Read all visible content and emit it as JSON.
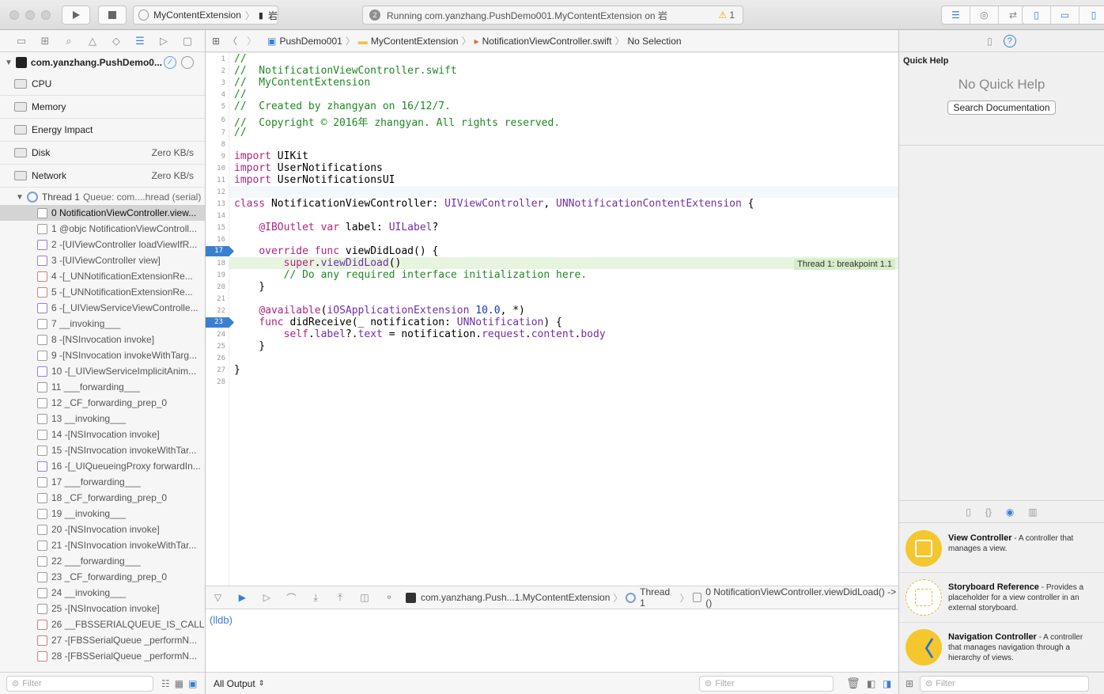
{
  "toolbar": {
    "scheme_target": "MyContentExtension",
    "scheme_device": "岩",
    "status_text": "Running com.yanzhang.PushDemo001.MyContentExtension on 岩",
    "status_badge": "2",
    "warning_count": "1"
  },
  "navigator": {
    "process_name": "com.yanzhang.PushDemo0...",
    "gauges": [
      {
        "label": "CPU",
        "value": ""
      },
      {
        "label": "Memory",
        "value": ""
      },
      {
        "label": "Energy Impact",
        "value": ""
      },
      {
        "label": "Disk",
        "value": "Zero KB/s"
      },
      {
        "label": "Network",
        "value": "Zero KB/s"
      }
    ],
    "thread_label": "Thread 1",
    "thread_queue": "Queue: com....hread (serial)",
    "frames": [
      {
        "text": "0 NotificationViewController.view...",
        "kind": "n"
      },
      {
        "text": "1 @objc NotificationViewControll...",
        "kind": "n"
      },
      {
        "text": "2 -[UIViewController loadViewIfR...",
        "kind": "p"
      },
      {
        "text": "3 -[UIViewController view]",
        "kind": "p"
      },
      {
        "text": "4 -[_UNNotificationExtensionRe...",
        "kind": "r"
      },
      {
        "text": "5 -[_UNNotificationExtensionRe...",
        "kind": "r"
      },
      {
        "text": "6 -[_UIViewServiceViewControlle...",
        "kind": "p"
      },
      {
        "text": "7 __invoking___",
        "kind": "n"
      },
      {
        "text": "8 -[NSInvocation invoke]",
        "kind": "n"
      },
      {
        "text": "9 -[NSInvocation invokeWithTarg...",
        "kind": "n"
      },
      {
        "text": "10 -[_UIViewServiceImplicitAnim...",
        "kind": "p"
      },
      {
        "text": "11 ___forwarding___",
        "kind": "n"
      },
      {
        "text": "12 _CF_forwarding_prep_0",
        "kind": "n"
      },
      {
        "text": "13 __invoking___",
        "kind": "n"
      },
      {
        "text": "14 -[NSInvocation invoke]",
        "kind": "n"
      },
      {
        "text": "15 -[NSInvocation invokeWithTar...",
        "kind": "n"
      },
      {
        "text": "16 -[_UIQueueingProxy forwardIn...",
        "kind": "p"
      },
      {
        "text": "17 ___forwarding___",
        "kind": "n"
      },
      {
        "text": "18 _CF_forwarding_prep_0",
        "kind": "n"
      },
      {
        "text": "19 __invoking___",
        "kind": "n"
      },
      {
        "text": "20 -[NSInvocation invoke]",
        "kind": "n"
      },
      {
        "text": "21 -[NSInvocation invokeWithTar...",
        "kind": "n"
      },
      {
        "text": "22 ___forwarding___",
        "kind": "n"
      },
      {
        "text": "23 _CF_forwarding_prep_0",
        "kind": "n"
      },
      {
        "text": "24 __invoking___",
        "kind": "n"
      },
      {
        "text": "25 -[NSInvocation invoke]",
        "kind": "n"
      },
      {
        "text": "26 __FBSSERIALQUEUE_IS_CALL...",
        "kind": "r"
      },
      {
        "text": "27 -[FBSSerialQueue _performN...",
        "kind": "r"
      },
      {
        "text": "28 -[FBSSerialQueue _performN...",
        "kind": "r"
      }
    ],
    "filter_placeholder": "Filter"
  },
  "jumpbar": {
    "project": "PushDemo001",
    "group": "MyContentExtension",
    "file": "NotificationViewController.swift",
    "selection": "No Selection"
  },
  "editor": {
    "breakpoint_label": "Thread 1: breakpoint 1.1",
    "breakpoint_lines": [
      "17",
      "23"
    ]
  },
  "debugbar": {
    "process": "com.yanzhang.Push...1.MyContentExtension",
    "thread": "Thread 1",
    "frame": "0 NotificationViewController.viewDidLoad() -> ()"
  },
  "console": {
    "prompt": "(lldb)",
    "output_selector": "All Output",
    "filter_placeholder": "Filter"
  },
  "inspector": {
    "title": "Quick Help",
    "empty_text": "No Quick Help",
    "search_button": "Search Documentation",
    "library": [
      {
        "name": "View Controller",
        "desc": " - A controller that manages a view."
      },
      {
        "name": "Storyboard Reference",
        "desc": " - Provides a placeholder for a view controller in an external storyboard."
      },
      {
        "name": "Navigation Controller",
        "desc": " - A controller that manages navigation through a hierarchy of views."
      }
    ],
    "filter_placeholder": "Filter"
  },
  "colors": {
    "comment": "#1e8a22",
    "keyword": "#b0247f",
    "type": "#6f2fa8",
    "number": "#1b33d0",
    "breakpoint": "#3b7fcf",
    "library_icon": "#f5c72e"
  }
}
